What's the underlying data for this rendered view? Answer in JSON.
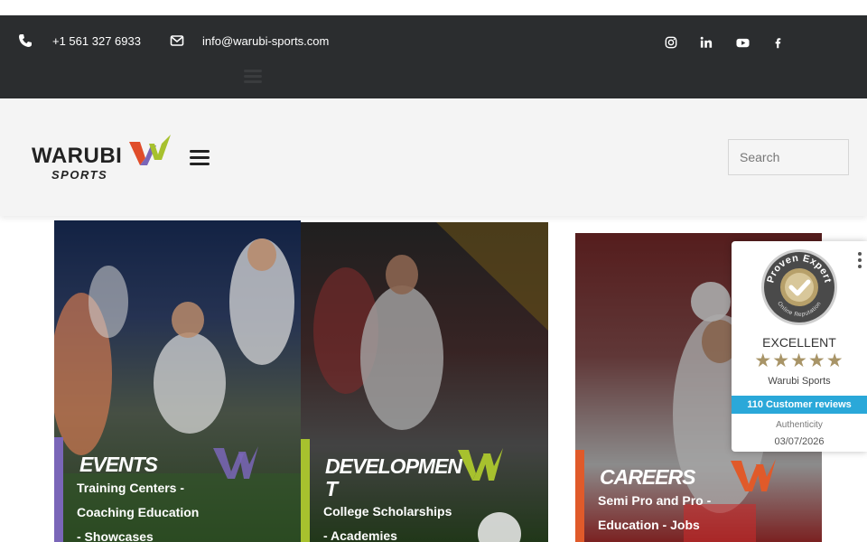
{
  "topbar": {
    "phone": "+1 561 327 6933",
    "email": "info@warubi-sports.com",
    "social_icons": [
      "instagram-icon",
      "linkedin-icon",
      "youtube-icon",
      "facebook-icon"
    ]
  },
  "header": {
    "logo_main": "WARUBI",
    "logo_sub": "SPORTS",
    "search_placeholder": "Search"
  },
  "cards": [
    {
      "title": "EVENTS",
      "lines": [
        "Training Centers -",
        "Coaching Education",
        "- Showcases"
      ],
      "accent": "#7a66b8"
    },
    {
      "title_line1": "DEVELOPMEN",
      "title_line2": "T",
      "lines": [
        "College Scholarships",
        "- Academies"
      ],
      "accent": "#a7c12e"
    },
    {
      "title": "CAREERS",
      "lines": [
        "Semi Pro and Pro -",
        "Education - Jobs"
      ],
      "accent": "#e05a2a"
    }
  ],
  "badge": {
    "rating": "EXCELLENT",
    "stars": "★★★★★",
    "company": "Warubi Sports",
    "reviews": "110 Customer reviews",
    "authenticity_label": "Authenticity",
    "date": "03/07/2026",
    "seal_top": "Proven Expert",
    "seal_bottom": "Online Reputation"
  },
  "colors": {
    "topbar": "#2b2d2f",
    "header": "#f4f4f4",
    "badge_accent": "#2aa8d9",
    "star": "#a89467"
  }
}
